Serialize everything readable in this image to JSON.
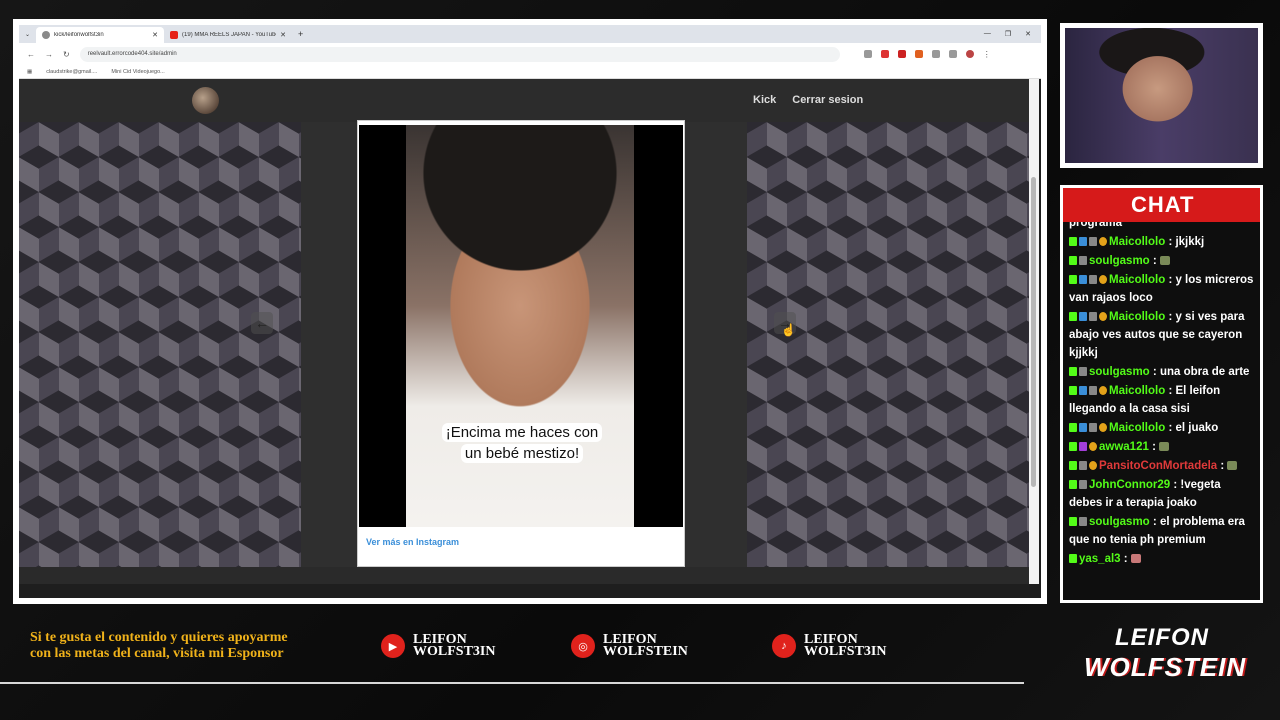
{
  "browser": {
    "tabs": [
      {
        "title": "kick/leifonwolfst3in",
        "active": true
      },
      {
        "title": "(19) MMA REELS JAPAN - YouTube",
        "active": false
      }
    ],
    "url": "reelvault.errorcode404.site/admin",
    "bookmarks": [
      "claudstrike@gmail....",
      "Mini Cid Videojuego..."
    ]
  },
  "site": {
    "nav": [
      "Kick",
      "Cerrar sesion"
    ],
    "video_caption": "¡Encima me haces con un bebé mestizo!",
    "instagram_link": "Ver más en Instagram"
  },
  "chat": {
    "title": "CHAT",
    "messages": [
      {
        "user": "",
        "text": "programa"
      },
      {
        "user": "Maicollolo",
        "text": ": jkjkkj"
      },
      {
        "user": "soulgasmo",
        "text": ":"
      },
      {
        "user": "Maicollolo",
        "text": ": y los micreros van rajaos loco"
      },
      {
        "user": "Maicollolo",
        "text": ": y si ves para abajo ves autos que se cayeron kjjkkj"
      },
      {
        "user": "soulgasmo",
        "text": ": una obra de arte"
      },
      {
        "user": "Maicollolo",
        "text": ": El leifon llegando a la casa sisi"
      },
      {
        "user": "Maicollolo",
        "text": ": el juako"
      },
      {
        "user": "awwa121",
        "text": ":"
      },
      {
        "user": "PansitoConMortadela",
        "text": ":"
      },
      {
        "user": "JohnConnor29",
        "text": ": !vegeta debes ir a terapia joako"
      },
      {
        "user": "soulgasmo",
        "text": ": el problema era que no tenia ph premium"
      },
      {
        "user": "yas_al3",
        "text": ":"
      }
    ]
  },
  "footer": {
    "sponsor_text": "Si te gusta el contenido y quieres apoyarme con las metas del canal, visita mi Esponsor",
    "youtube_line1": "LEIFON",
    "youtube_line2": "WOLFST3IN",
    "instagram_line1": "LEIFON",
    "instagram_line2": "WOLFSTEIN",
    "tiktok_line1": "LEIFON",
    "tiktok_line2": "WOLFST3IN",
    "logo_line1": "LEIFON",
    "logo_line2": "WOLFSTEIN"
  }
}
